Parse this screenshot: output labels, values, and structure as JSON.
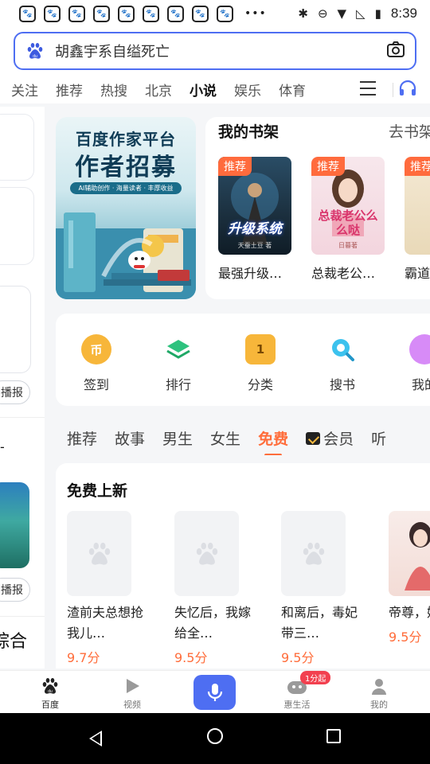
{
  "status_bar": {
    "time": "8:39",
    "notification_count": 9,
    "more": "•••"
  },
  "search": {
    "query": "胡鑫宇系自缢死亡"
  },
  "channel_tabs": [
    "关注",
    "推荐",
    "热搜",
    "北京",
    "小说",
    "娱乐",
    "体育"
  ],
  "channel_active": "小说",
  "banner": {
    "line1": "百度作家平台",
    "line2": "作者招募",
    "sub": "AI辅助创作 · 海量读者 · 丰厚收益"
  },
  "bookshelf": {
    "title": "我的书架",
    "link": "去书架",
    "books": [
      {
        "tag": "推荐",
        "title": "最强升级…",
        "cover_text": "升级系统",
        "cover_author": "天蚕土豆 著"
      },
      {
        "tag": "推荐",
        "title": "总裁老公…",
        "cover_text": "总裁老公么么哒",
        "cover_author": "日暮著"
      },
      {
        "tag": "推荐",
        "title": "霸道"
      }
    ]
  },
  "quick_menu": [
    {
      "label": "签到",
      "icon": "coin-icon",
      "glyph": "币",
      "color": "#f5a623"
    },
    {
      "label": "排行",
      "icon": "layers-icon",
      "glyph": "",
      "color": "#2ec27e"
    },
    {
      "label": "分类",
      "icon": "category-icon",
      "glyph": "1",
      "color": "#f5a623"
    },
    {
      "label": "搜书",
      "icon": "search-book-icon",
      "glyph": "",
      "color": "#2eb8e6"
    },
    {
      "label": "我的",
      "icon": "user-icon",
      "glyph": "",
      "color": "#c26cf2"
    }
  ],
  "category_tabs": [
    "推荐",
    "故事",
    "男生",
    "女生",
    "免费",
    "会员",
    "听"
  ],
  "category_active": "免费",
  "free_section": {
    "title": "免费上新",
    "books": [
      {
        "title": "渣前夫总想抢我儿…",
        "score": "9.7分"
      },
      {
        "title": "失忆后，我嫁给全…",
        "score": "9.5分"
      },
      {
        "title": "和离后，毒妃带三…",
        "score": "9.5分"
      },
      {
        "title": "帝尊，娘带崽",
        "score": "9.5分"
      }
    ]
  },
  "left_strip": {
    "pill_text": "播报",
    "heading": "综合"
  },
  "bottom_nav": [
    {
      "label": "百度",
      "icon": "baidu-paw-icon"
    },
    {
      "label": "视频",
      "icon": "video-play-icon"
    },
    {
      "label": "",
      "icon": "microphone-icon"
    },
    {
      "label": "惠生活",
      "icon": "life-icon",
      "badge": "1分起"
    },
    {
      "label": "我的",
      "icon": "profile-icon"
    }
  ],
  "colors": {
    "accent": "#4e6ef2",
    "orange": "#ff6d3b",
    "tag": "#ff6b3d"
  }
}
